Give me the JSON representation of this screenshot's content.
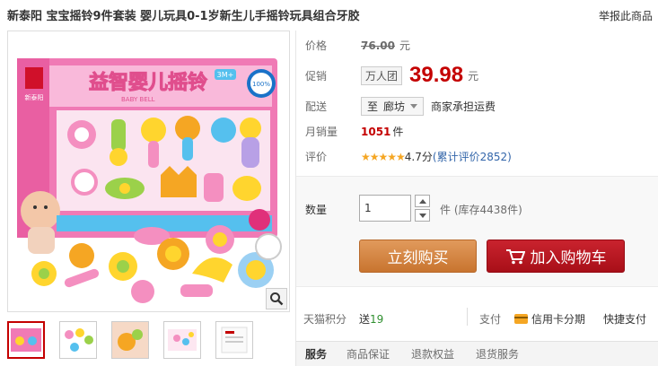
{
  "title": "新泰阳 宝宝摇铃9件套装 婴儿玩具0-1岁新生儿手摇铃玩具组合牙胶",
  "report_link": "举报此商品",
  "product_image": {
    "box_title": "益智婴儿摇铃",
    "box_subtitle": "BABY BELL",
    "age_badge": "3M+",
    "safety_badge": "100%",
    "brand_badge": "新泰阳",
    "colors": {
      "box_pink": "#f07ab5",
      "box_blue": "#55c0ee",
      "toy_yellow": "#ffd52e",
      "toy_green": "#9bd14a"
    }
  },
  "zoom_icon": "magnifier-icon",
  "thumbnails": [
    {
      "name": "thumb-1",
      "active": true
    },
    {
      "name": "thumb-2",
      "active": false
    },
    {
      "name": "thumb-3",
      "active": false
    },
    {
      "name": "thumb-4",
      "active": false
    },
    {
      "name": "thumb-5",
      "active": false
    }
  ],
  "info": {
    "price_label": "价格",
    "old_price": "76.00",
    "currency_unit": "元",
    "promo_label": "促销",
    "promo_tag": "万人团",
    "promo_price": "39.98",
    "delivery_label": "配送",
    "delivery_prefix": "至",
    "delivery_city": "廊坊",
    "delivery_note": "商家承担运费",
    "sales_label": "月销量",
    "sales_value": "1051",
    "sales_unit": "件",
    "rating_label": "评价",
    "stars": "★★★★★",
    "rating_score": "4.7分",
    "review_link": "(累计评价2852)"
  },
  "buy": {
    "qty_label": "数量",
    "qty_value": "1",
    "qty_unit": "件",
    "stock": "(库存4438件)",
    "buy_now": "立刻购买",
    "add_cart": "加入购物车"
  },
  "points": {
    "label": "天猫积分",
    "prefix": "送",
    "value": "19",
    "pay_label": "支付",
    "card_label": "信用卡分期",
    "quick_pay": "快捷支付"
  },
  "tabs": [
    "服务",
    "商品保证",
    "退款权益",
    "退货服务"
  ],
  "colors": {
    "accent_red": "#c40000",
    "buy_orange": "#d38445",
    "cart_red": "#b5151f",
    "link_blue": "#3366aa"
  }
}
